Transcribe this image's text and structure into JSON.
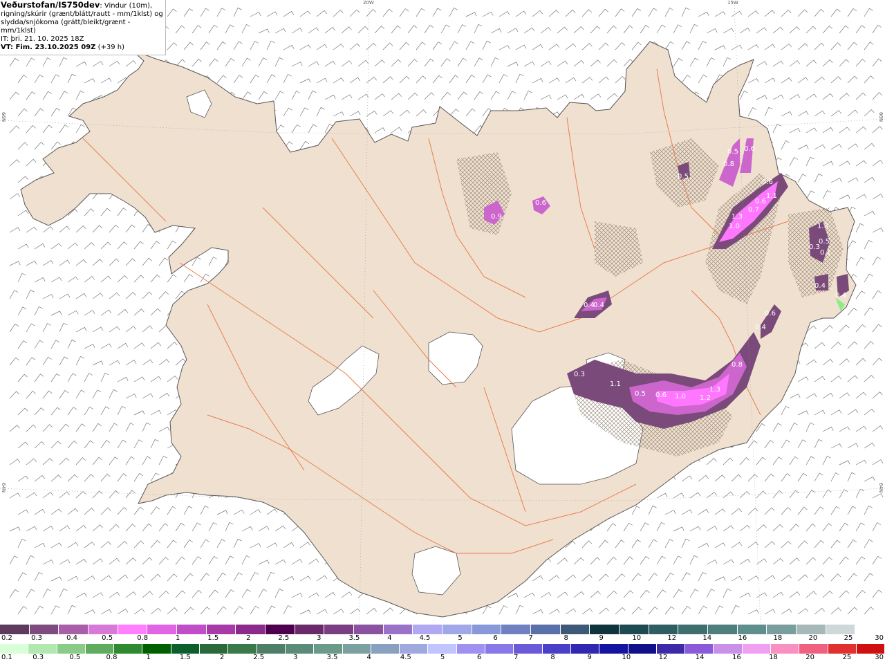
{
  "info": {
    "title": "Veðurstofan/IS750dev",
    "desc1": ": Vindur (10m),",
    "desc2": "rigning/skúrir (grænt/blátt/rautt - mm/1klst) og",
    "desc3": "slydda/snjókoma (grátt/bleikt/grænt - mm/1klst)",
    "it": "IT: þri. 21. 10. 2025 18Z",
    "vt": "VT: Fim. 23.10.2025 09Z",
    "vt_offset": "(+39 h)"
  },
  "coords": {
    "top_20w": "20W",
    "top_15w": "15W",
    "left_66n": "66N",
    "left_64n": "64N",
    "right_66n": "66N",
    "right_64n": "64N"
  },
  "colors": {
    "land": "#f0e0d0",
    "glacier": "#ffffff",
    "roads": "#e87f4f",
    "coastline": "#555555",
    "wind_barbs": "#666666",
    "snow_light": "#7a4a7a",
    "snow_mid": "#cc66cc",
    "snow_heavy": "#ff77ff"
  },
  "precip_labels": [
    {
      "id": "p1",
      "text": "0.9"
    },
    {
      "id": "p2",
      "text": "0.6"
    },
    {
      "id": "p3",
      "text": "0.6"
    },
    {
      "id": "p4",
      "text": "0.8"
    },
    {
      "id": "p5",
      "text": "0.5"
    },
    {
      "id": "p6",
      "text": "1.1"
    },
    {
      "id": "p7",
      "text": "0.6"
    },
    {
      "id": "p8",
      "text": "1.3"
    },
    {
      "id": "p9",
      "text": "1.0"
    },
    {
      "id": "p10",
      "text": "0.7"
    },
    {
      "id": "p11",
      "text": "1.3"
    },
    {
      "id": "p12",
      "text": "0.3"
    },
    {
      "id": "p13",
      "text": "0.5"
    },
    {
      "id": "p14",
      "text": "0.4"
    },
    {
      "id": "p15",
      "text": "0.4"
    },
    {
      "id": "p16",
      "text": "0.6"
    },
    {
      "id": "p17",
      "text": "0.4"
    },
    {
      "id": "p18",
      "text": "0.3"
    },
    {
      "id": "p19",
      "text": "1.1"
    },
    {
      "id": "p20",
      "text": "0.5"
    },
    {
      "id": "p21",
      "text": "0.6"
    },
    {
      "id": "p22",
      "text": "1.0"
    },
    {
      "id": "p23",
      "text": "1.2"
    },
    {
      "id": "p24",
      "text": "1.3"
    },
    {
      "id": "p25",
      "text": "0.8"
    },
    {
      "id": "p26",
      "text": "0.4"
    },
    {
      "id": "p27",
      "text": "0.5"
    },
    {
      "id": "p28",
      "text": "0.6"
    },
    {
      "id": "p29",
      "text": "0.4"
    },
    {
      "id": "p30",
      "text": "0.1"
    }
  ],
  "legend_snow": {
    "colors": [
      "#5e3a5e",
      "#7e4c7e",
      "#a85fa8",
      "#d77ad7",
      "#ff7fff",
      "#e066e6",
      "#c04ec8",
      "#a83aa8",
      "#8c2a8c",
      "#4d004d",
      "#6a2a6a",
      "#7a3f82",
      "#8a52a0",
      "#9a72c8",
      "#b0a8f0",
      "#a0a8e8",
      "#8898d8",
      "#7080c0",
      "#5a70a8",
      "#3e5878",
      "#10343c",
      "#1e4a52",
      "#2e5e62",
      "#3e6e6e",
      "#4e7e7e",
      "#5e8e8e",
      "#7a9e9e",
      "#a6b8b8",
      "#cfd8d8",
      "#ffffff"
    ],
    "labels": [
      "0.2",
      "0.3",
      "0.4",
      "0.5",
      "0.8",
      "1",
      "1.5",
      "2",
      "2.5",
      "3",
      "3.5",
      "4",
      "4.5",
      "5",
      "6",
      "7",
      "8",
      "9",
      "10",
      "12",
      "14",
      "16",
      "18",
      "20",
      "25",
      "30"
    ]
  },
  "legend_rain": {
    "colors": [
      "#d8ffd8",
      "#b0e8b0",
      "#88cc88",
      "#5fac5f",
      "#2e8a2e",
      "#006000",
      "#0a5f2a",
      "#2a6a3a",
      "#3a7a4a",
      "#4d7f66",
      "#5a8a78",
      "#6a9a8a",
      "#7aa0a0",
      "#8aa0c0",
      "#a0a8e0",
      "#c0c4ff",
      "#a090f0",
      "#8878e8",
      "#6a5ad8",
      "#4a40c8",
      "#3028b0",
      "#1414a0",
      "#101088",
      "#3c2aa8",
      "#8a5ad8",
      "#c890e8",
      "#f0a0f0",
      "#f890c0",
      "#f06080",
      "#e03030",
      "#d01010"
    ],
    "labels": [
      "0.1",
      "0.3",
      "0.5",
      "0.8",
      "1",
      "1.5",
      "2",
      "2.5",
      "3",
      "3.5",
      "4",
      "4.5",
      "5",
      "6",
      "7",
      "8",
      "9",
      "10",
      "12",
      "14",
      "16",
      "18",
      "20",
      "25",
      "30"
    ]
  }
}
